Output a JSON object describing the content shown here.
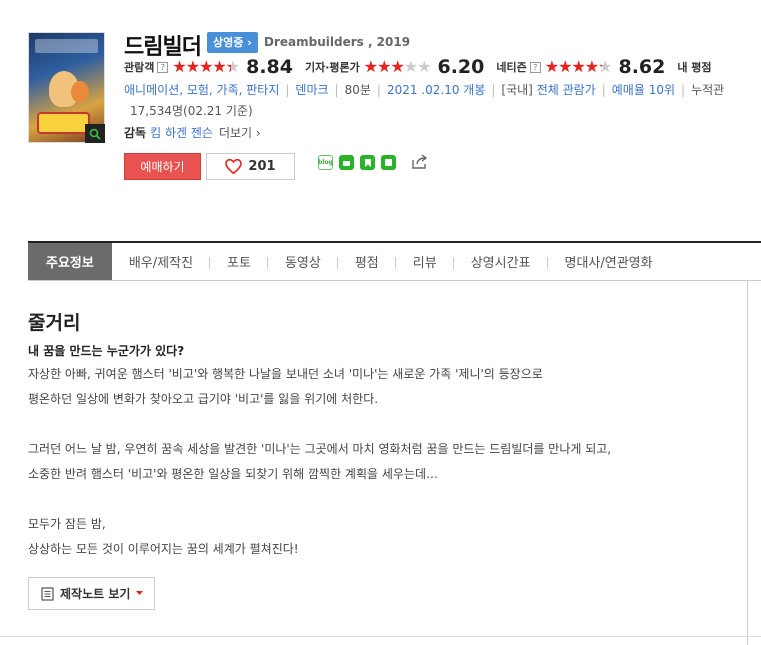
{
  "movie": {
    "title": "드림빌더",
    "status_badge": "상영중 ›",
    "english_title": "Dreambuilders , 2019"
  },
  "ratings": {
    "audience": {
      "label": "관람객",
      "score": "8.84",
      "stars_fraction": 0.884
    },
    "critics": {
      "label": "기자·평론가",
      "score": "6.20",
      "stars_fraction": 0.62
    },
    "netizen": {
      "label": "네티즌",
      "score": "8.62",
      "stars_fraction": 0.862
    },
    "my_label": "내 평점",
    "help_glyph": "?"
  },
  "info": {
    "genres": "애니메이션, 모험, 가족, 판타지",
    "country": "덴마크",
    "runtime": "80분",
    "release": "2021 .02.10 개봉",
    "rating_country": "[국내]",
    "rating": "전체 관람가",
    "reservation_rank": "예매율 10위",
    "cumulative_label": "누적관",
    "cumulative_value": "17,534명(02.21 기준)"
  },
  "director": {
    "label": "감독",
    "names": "킴 하겐 젠슨",
    "more": "더보기 ›"
  },
  "actions": {
    "book_label": "예매하기",
    "like_count": "201",
    "share_blog": "blog",
    "colors": {
      "book": "#e85250",
      "heart": "#e8231f",
      "star": "#e8231f"
    }
  },
  "tabs": [
    "주요정보",
    "배우/제작진",
    "포토",
    "동영상",
    "평점",
    "리뷰",
    "상영시간표",
    "명대사/연관영화"
  ],
  "synopsis": {
    "heading": "줄거리",
    "tagline": "내 꿈을 만드는 누군가가 있다?",
    "lines": [
      "자상한 아빠, 귀여운 햄스터 '비고'와 행복한 나날을 보내던 소녀 '미나'는 새로운 가족 '제니'의 등장으로",
      " 평온하던 일상에 변화가 찾아오고 급기야 '비고'를 잃을 위기에 처한다.",
      "",
      " 그러던 어느 날 밤, 우연히 꿈속 세상을 발견한 '미나'는 그곳에서 마치 영화처럼 꿈을 만드는 드림빌더를 만나게 되고,",
      " 소중한 반려 햄스터 '비고'와 평온한 일상을 되찾기 위해 깜찍한 계획을 세우는데…",
      "",
      " 모두가 잠든 밤,",
      " 상상하는 모든 것이 이루어지는 꿈의 세계가 펼쳐진다!"
    ],
    "note_button": "제작노트 보기"
  }
}
